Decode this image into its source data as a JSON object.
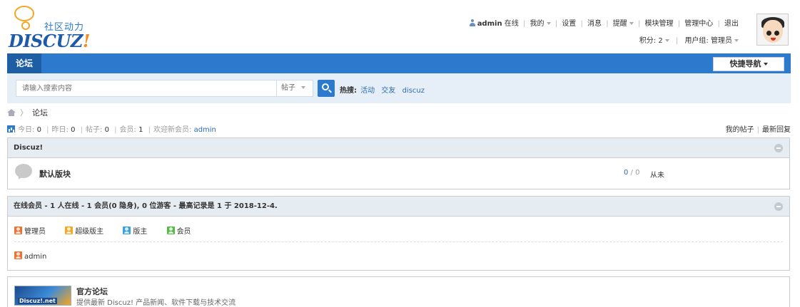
{
  "logo": {
    "slogan": "社区动力",
    "brand": "DISCUZ",
    "bang": "!"
  },
  "userbar": {
    "username": "admin",
    "online": "在线",
    "items": [
      "我的",
      "设置",
      "消息",
      "提醒",
      "模块管理",
      "管理中心",
      "退出"
    ],
    "credits": "积分: 2",
    "group": "用户组: 管理员"
  },
  "nav": {
    "tab": "论坛",
    "quick": "快捷导航"
  },
  "search": {
    "placeholder": "请输入搜索内容",
    "type": "帖子",
    "hot_label": "热搜:",
    "hot": [
      "活动",
      "交友",
      "discuz"
    ]
  },
  "breadcrumb": {
    "current": "论坛"
  },
  "stats": {
    "today_label": "今日:",
    "today": "0",
    "yesterday_label": "昨日:",
    "yesterday": "0",
    "posts_label": "帖子:",
    "posts": "0",
    "members_label": "会员:",
    "members": "1",
    "welcome": "欢迎新会员:",
    "newest": "admin",
    "my_posts": "我的帖子",
    "latest_replies": "最新回复"
  },
  "category": {
    "title": "Discuz!",
    "forum": {
      "name": "默认版块",
      "threads": "0",
      "posts": "0",
      "last": "从未"
    }
  },
  "online": {
    "title": "在线会员 - 1 人在线 - 1 会员(0 隐身), 0 位游客 - 最高记录是 1 于 2018-12-4.",
    "legend": [
      "管理员",
      "超级版主",
      "版主",
      "会员"
    ],
    "users": [
      "admin"
    ]
  },
  "links": {
    "logo_text": "Discuz!.net",
    "name": "官方论坛",
    "desc": "提供最新 Discuz! 产品新闻、软件下载与技术交流"
  }
}
